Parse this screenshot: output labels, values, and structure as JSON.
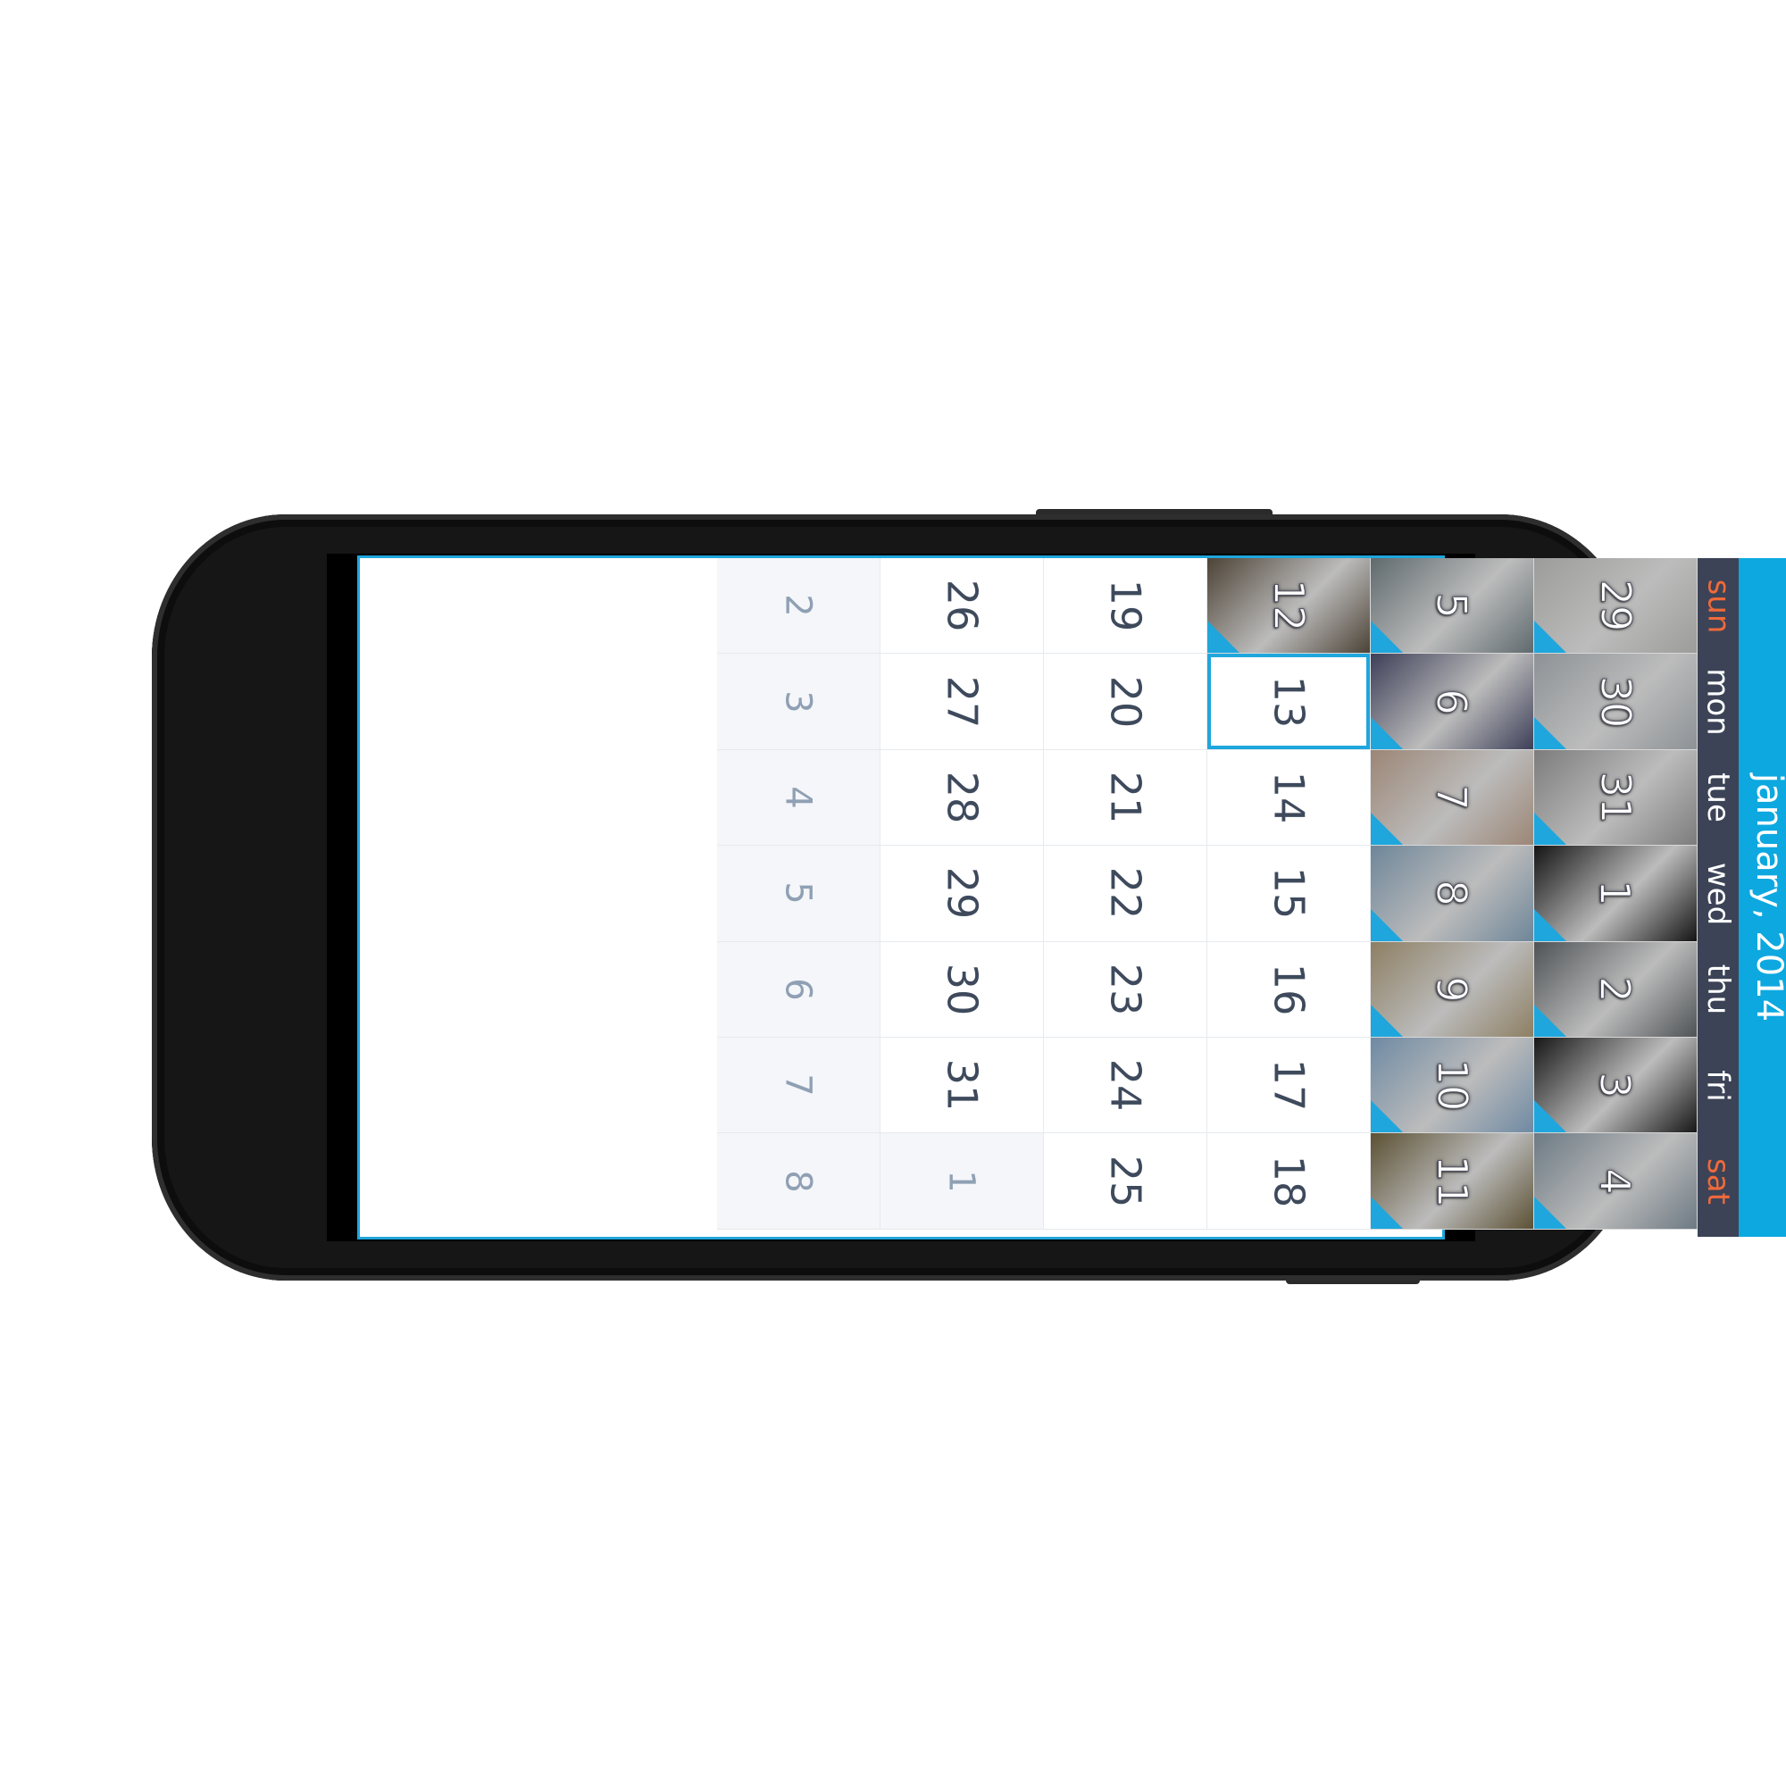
{
  "calendar": {
    "title": "january, 2014",
    "weekdays": [
      "sun",
      "mon",
      "tue",
      "wed",
      "thu",
      "fri",
      "sat"
    ],
    "selected_day": "13",
    "weeks": [
      {
        "days": [
          {
            "label": "29",
            "photo": true,
            "in_month": false,
            "tint": "#9c9c9a"
          },
          {
            "label": "30",
            "photo": true,
            "in_month": false,
            "tint": "#8d9296"
          },
          {
            "label": "31",
            "photo": true,
            "in_month": false,
            "tint": "#7c7c7c"
          },
          {
            "label": "1",
            "photo": true,
            "in_month": true,
            "tint": "#141414"
          },
          {
            "label": "2",
            "photo": true,
            "in_month": true,
            "tint": "#4f5356"
          },
          {
            "label": "3",
            "photo": true,
            "in_month": true,
            "tint": "#171717"
          },
          {
            "label": "4",
            "photo": true,
            "in_month": true,
            "tint": "#6d7a84"
          }
        ]
      },
      {
        "days": [
          {
            "label": "5",
            "photo": true,
            "in_month": true,
            "tint": "#5f6a6e"
          },
          {
            "label": "6",
            "photo": true,
            "in_month": true,
            "tint": "#3d3f58"
          },
          {
            "label": "7",
            "photo": true,
            "in_month": true,
            "tint": "#9c8676"
          },
          {
            "label": "8",
            "photo": true,
            "in_month": true,
            "tint": "#6e8699"
          },
          {
            "label": "9",
            "photo": true,
            "in_month": true,
            "tint": "#8d7f63"
          },
          {
            "label": "10",
            "photo": true,
            "in_month": true,
            "tint": "#6f8aa3"
          },
          {
            "label": "11",
            "photo": true,
            "in_month": true,
            "tint": "#5c5134"
          }
        ]
      },
      {
        "days": [
          {
            "label": "12",
            "photo": true,
            "in_month": true,
            "tint": "#4d4336"
          },
          {
            "label": "13",
            "photo": false,
            "in_month": true
          },
          {
            "label": "14",
            "photo": false,
            "in_month": true
          },
          {
            "label": "15",
            "photo": false,
            "in_month": true
          },
          {
            "label": "16",
            "photo": false,
            "in_month": true
          },
          {
            "label": "17",
            "photo": false,
            "in_month": true
          },
          {
            "label": "18",
            "photo": false,
            "in_month": true
          }
        ]
      },
      {
        "days": [
          {
            "label": "19",
            "photo": false,
            "in_month": true
          },
          {
            "label": "20",
            "photo": false,
            "in_month": true
          },
          {
            "label": "21",
            "photo": false,
            "in_month": true
          },
          {
            "label": "22",
            "photo": false,
            "in_month": true
          },
          {
            "label": "23",
            "photo": false,
            "in_month": true
          },
          {
            "label": "24",
            "photo": false,
            "in_month": true
          },
          {
            "label": "25",
            "photo": false,
            "in_month": true
          }
        ]
      },
      {
        "days": [
          {
            "label": "26",
            "photo": false,
            "in_month": true
          },
          {
            "label": "27",
            "photo": false,
            "in_month": true
          },
          {
            "label": "28",
            "photo": false,
            "in_month": true
          },
          {
            "label": "29",
            "photo": false,
            "in_month": true
          },
          {
            "label": "30",
            "photo": false,
            "in_month": true
          },
          {
            "label": "31",
            "photo": false,
            "in_month": true
          },
          {
            "label": "1",
            "photo": false,
            "in_month": false
          }
        ]
      },
      {
        "days": [
          {
            "label": "2",
            "photo": false,
            "in_month": false
          },
          {
            "label": "3",
            "photo": false,
            "in_month": false
          },
          {
            "label": "4",
            "photo": false,
            "in_month": false
          },
          {
            "label": "5",
            "photo": false,
            "in_month": false
          },
          {
            "label": "6",
            "photo": false,
            "in_month": false
          },
          {
            "label": "7",
            "photo": false,
            "in_month": false
          },
          {
            "label": "8",
            "photo": false,
            "in_month": false
          }
        ]
      }
    ]
  },
  "colors": {
    "accent": "#1fa6dd",
    "title_bar": "#0da8e0",
    "weekday_bar": "#3c4357",
    "weekend_label": "#f06a3a"
  }
}
